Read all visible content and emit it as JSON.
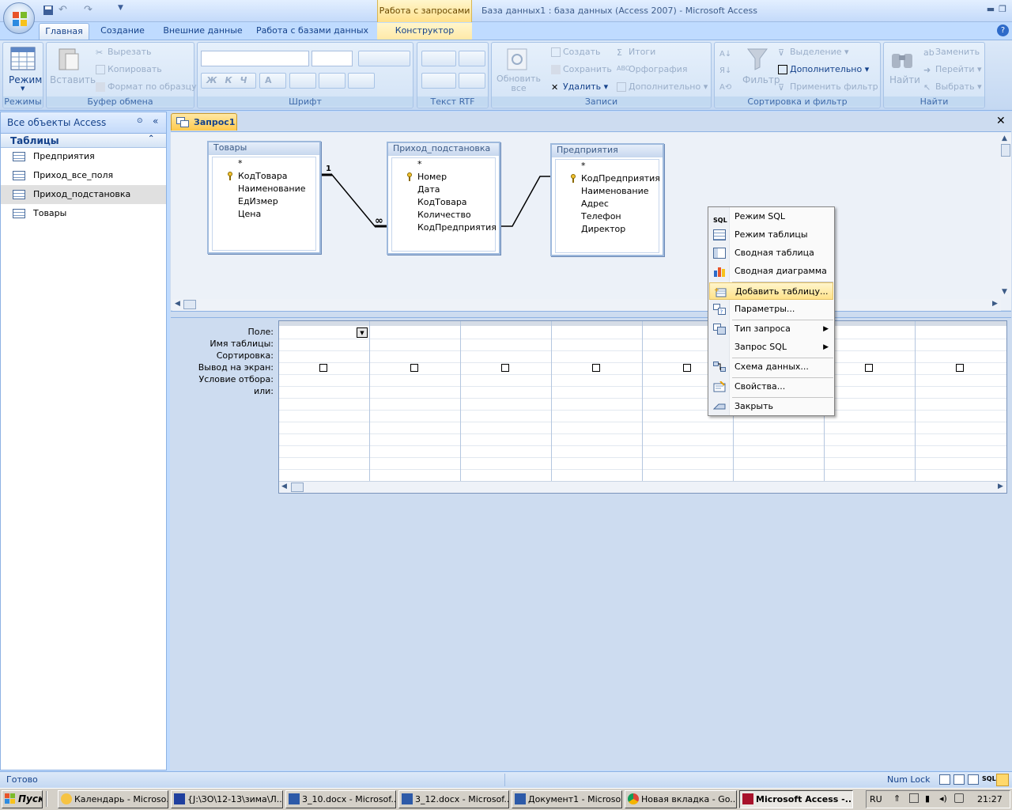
{
  "window": {
    "title": "База данных1 : база данных (Access 2007) - Microsoft Access",
    "context_tab_title": "Работа с запросами"
  },
  "tabs": [
    "Главная",
    "Создание",
    "Внешние данные",
    "Работа с базами данных",
    "Конструктор"
  ],
  "ribbon": {
    "views": {
      "label": "Режим",
      "group": "Режимы"
    },
    "clipboard": {
      "paste": "Вставить",
      "cut": "Вырезать",
      "copy": "Копировать",
      "format_painter": "Формат по образцу",
      "group": "Буфер обмена"
    },
    "font": {
      "group": "Шрифт",
      "bold": "Ж",
      "italic": "К",
      "underline": "Ч",
      "color": "A"
    },
    "rtf": {
      "group": "Текст RTF"
    },
    "records": {
      "refresh": "Обновить все",
      "new": "Создать",
      "save": "Сохранить",
      "delete": "Удалить",
      "totals": "Итоги",
      "spelling": "Орфография",
      "more": "Дополнительно",
      "group": "Записи"
    },
    "sort": {
      "filter": "Фильтр",
      "selection": "Выделение",
      "advanced": "Дополнительно",
      "toggle": "Применить фильтр",
      "group": "Сортировка и фильтр"
    },
    "find": {
      "find": "Найти",
      "replace": "Заменить",
      "goto": "Перейти",
      "select": "Выбрать",
      "group": "Найти"
    }
  },
  "nav": {
    "header": "Все объекты Access",
    "group": "Таблицы",
    "items": [
      "Предприятия",
      "Приход_все_поля",
      "Приход_подстановка",
      "Товары"
    ]
  },
  "doc_tab": "Запрос1",
  "tables": [
    {
      "name": "Товары",
      "fields": [
        "*",
        "КодТовара",
        "Наименование",
        "ЕдИзмер",
        "Цена"
      ]
    },
    {
      "name": "Приход_подстановка",
      "fields": [
        "*",
        "Номер",
        "Дата",
        "КодТовара",
        "Количество",
        "КодПредприятия"
      ]
    },
    {
      "name": "Предприятия",
      "fields": [
        "*",
        "КодПредприятия",
        "Наименование",
        "Адрес",
        "Телефон",
        "Директор"
      ]
    }
  ],
  "relation_labels": {
    "one": "1",
    "many": "∞"
  },
  "grid_labels": [
    "Поле:",
    "Имя таблицы:",
    "Сортировка:",
    "Вывод на экран:",
    "Условие отбора:",
    "или:"
  ],
  "context_menu": [
    {
      "label": "Режим SQL",
      "icon": "sql-icon"
    },
    {
      "label": "Режим таблицы",
      "icon": "datasheet-icon"
    },
    {
      "label": "Сводная таблица",
      "icon": "pivot-table-icon"
    },
    {
      "label": "Сводная диаграмма",
      "icon": "pivot-chart-icon"
    },
    {
      "label": "Добавить таблицу...",
      "icon": "add-table-icon"
    },
    {
      "label": "Параметры...",
      "icon": "parameters-icon"
    },
    {
      "label": "Тип запроса",
      "icon": "query-type-icon"
    },
    {
      "label": "Запрос SQL",
      "icon": ""
    },
    {
      "label": "Схема данных...",
      "icon": "relationships-icon"
    },
    {
      "label": "Свойства...",
      "icon": "properties-icon"
    },
    {
      "label": "Закрыть",
      "icon": "close-icon"
    }
  ],
  "status": {
    "text": "Готово",
    "numlock": "Num Lock",
    "sql": "SQL"
  },
  "taskbar": {
    "start": "Пуск",
    "items": [
      "Календарь - Microso...",
      "{J:\\ЗО\\12-13\\зима\\Л...",
      "3_10.docx - Microsof...",
      "3_12.docx - Microsof...",
      "Документ1 - Microso...",
      "Новая вкладка - Go...",
      "Microsoft Access -..."
    ],
    "lang": "RU",
    "time": "21:27"
  }
}
